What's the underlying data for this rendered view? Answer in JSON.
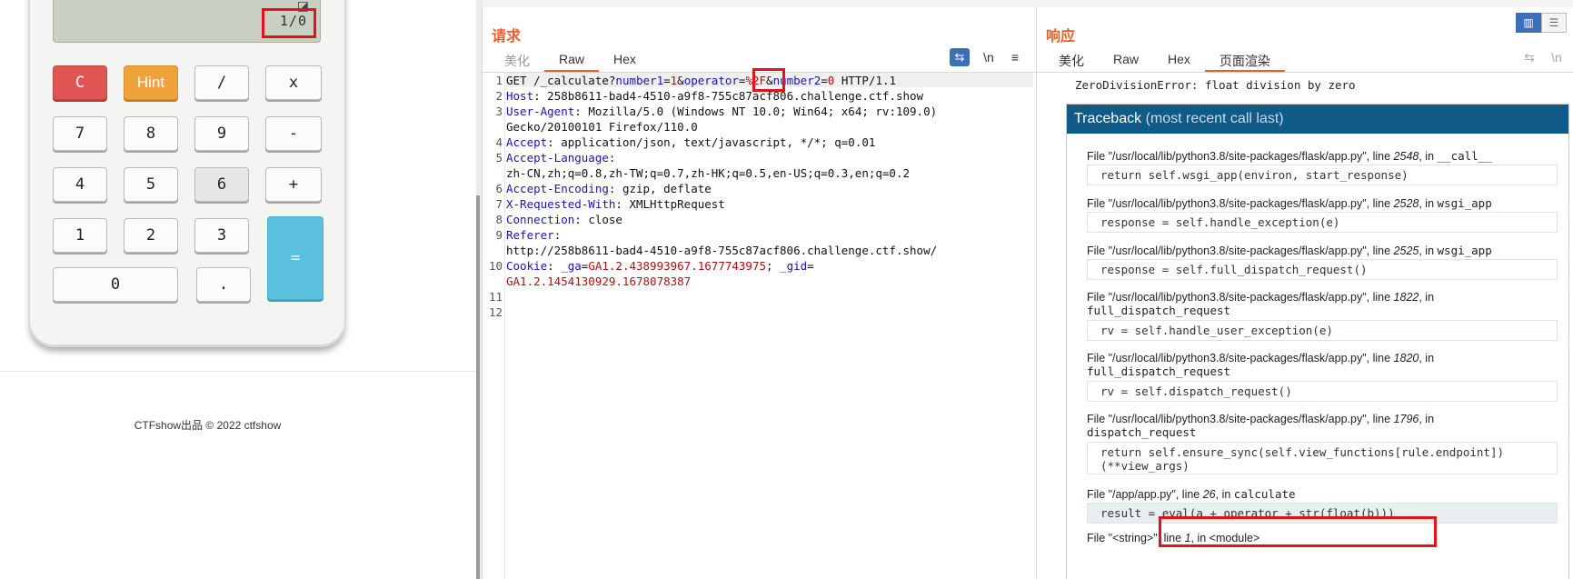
{
  "calculator": {
    "screen_value": "1/0",
    "screen_glyph": "◪",
    "keys": {
      "clear": "C",
      "hint": "Hint",
      "divide": "/",
      "multiply": "x",
      "seven": "7",
      "eight": "8",
      "nine": "9",
      "minus": "-",
      "four": "4",
      "five": "5",
      "six": "6",
      "plus": "+",
      "one": "1",
      "two": "2",
      "three": "3",
      "equals": "=",
      "zero": "0",
      "dot": "."
    },
    "footer": "CTFshow出品 © 2022 ctfshow",
    "colors": {
      "clear": "#df5553",
      "hint": "#f0a23b",
      "equals": "#5bc0de",
      "screen": "#c9d0c3"
    }
  },
  "request": {
    "title": "请求",
    "tabs": [
      "美化",
      "Raw",
      "Hex"
    ],
    "active_tab": "Raw",
    "toolbar": {
      "wrap_icon": "wrap-icon",
      "newline_label": "\\n",
      "menu_icon": "menu-icon"
    },
    "lines": {
      "l1_method": "GET /_calculate?",
      "l1_p1_key": "number1",
      "l1_p1_val": "1",
      "l1_p2_key": "operator",
      "l1_p2_val": "%2F",
      "l1_p3_key": "number2",
      "l1_p3_val": "0",
      "l1_proto": " HTTP/1.1",
      "host_key": "Host",
      "host_val": " 258b8611-bad4-4510-a9f8-755c87acf806.challenge.ctf.show",
      "ua_key": "User-Agent",
      "ua_val": " Mozilla/5.0 (Windows NT 10.0; Win64; x64; rv:109.0)",
      "ua_val2": "Gecko/20100101 Firefox/110.0",
      "accept_key": "Accept",
      "accept_val": " application/json, text/javascript, */*; q=0.01",
      "lang_key": "Accept-Language",
      "lang_val": "zh-CN,zh;q=0.8,zh-TW;q=0.7,zh-HK;q=0.5,en-US;q=0.3,en;q=0.2",
      "enc_key": "Accept-Encoding",
      "enc_val": " gzip, deflate",
      "xrw_key": "X-Requested-With",
      "xrw_val": " XMLHttpRequest",
      "conn_key": "Connection",
      "conn_val": " close",
      "ref_key": "Referer",
      "ref_val": "http://258b8611-bad4-4510-a9f8-755c87acf806.challenge.ctf.show/",
      "cookie_key": "Cookie",
      "cookie_ga_key": "_ga",
      "cookie_ga_val": "GA1.2.438993967.1677743975",
      "cookie_gid_key": "_gid",
      "cookie_gid_val": "GA1.2.1454130929.1678078387"
    },
    "line_numbers": [
      "1",
      "2",
      "3",
      "4",
      "5",
      "6",
      "7",
      "8",
      "9",
      "10",
      "11",
      "12"
    ]
  },
  "response": {
    "title": "响应",
    "tabs": [
      "美化",
      "Raw",
      "Hex",
      "页面渲染"
    ],
    "active_tab": "页面渲染",
    "error_line": "ZeroDivisionError: float division by zero",
    "traceback_title": "Traceback",
    "traceback_sub": "(most recent call last)",
    "frames": [
      {
        "file": "\"/usr/local/lib/python3.8/site-packages/flask/app.py\"",
        "line": "2548",
        "func": "__call__",
        "code": "return self.wsgi_app(environ, start_response)"
      },
      {
        "file": "\"/usr/local/lib/python3.8/site-packages/flask/app.py\"",
        "line": "2528",
        "func": "wsgi_app",
        "code": "response = self.handle_exception(e)"
      },
      {
        "file": "\"/usr/local/lib/python3.8/site-packages/flask/app.py\"",
        "line": "2525",
        "func": "wsgi_app",
        "code": "response = self.full_dispatch_request()"
      },
      {
        "file": "\"/usr/local/lib/python3.8/site-packages/flask/app.py\"",
        "line": "1822",
        "func": "full_dispatch_request",
        "code": "rv = self.handle_user_exception(e)"
      },
      {
        "file": "\"/usr/local/lib/python3.8/site-packages/flask/app.py\"",
        "line": "1820",
        "func": "full_dispatch_request",
        "code": "rv = self.dispatch_request()"
      },
      {
        "file": "\"/usr/local/lib/python3.8/site-packages/flask/app.py\"",
        "line": "1796",
        "func": "dispatch_request",
        "code": "return self.ensure_sync(self.view_functions[rule.endpoint])(**view_args)"
      },
      {
        "file": "\"/app/app.py\"",
        "line": "26",
        "func": "calculate",
        "code": "result = eval(a + operator + str(float(b)))"
      },
      {
        "file": "\"<string>\"",
        "line": "1",
        "func": "<module>",
        "code": ""
      }
    ],
    "labels": {
      "file": "File ",
      "line": ", line ",
      "in": ", in "
    }
  }
}
